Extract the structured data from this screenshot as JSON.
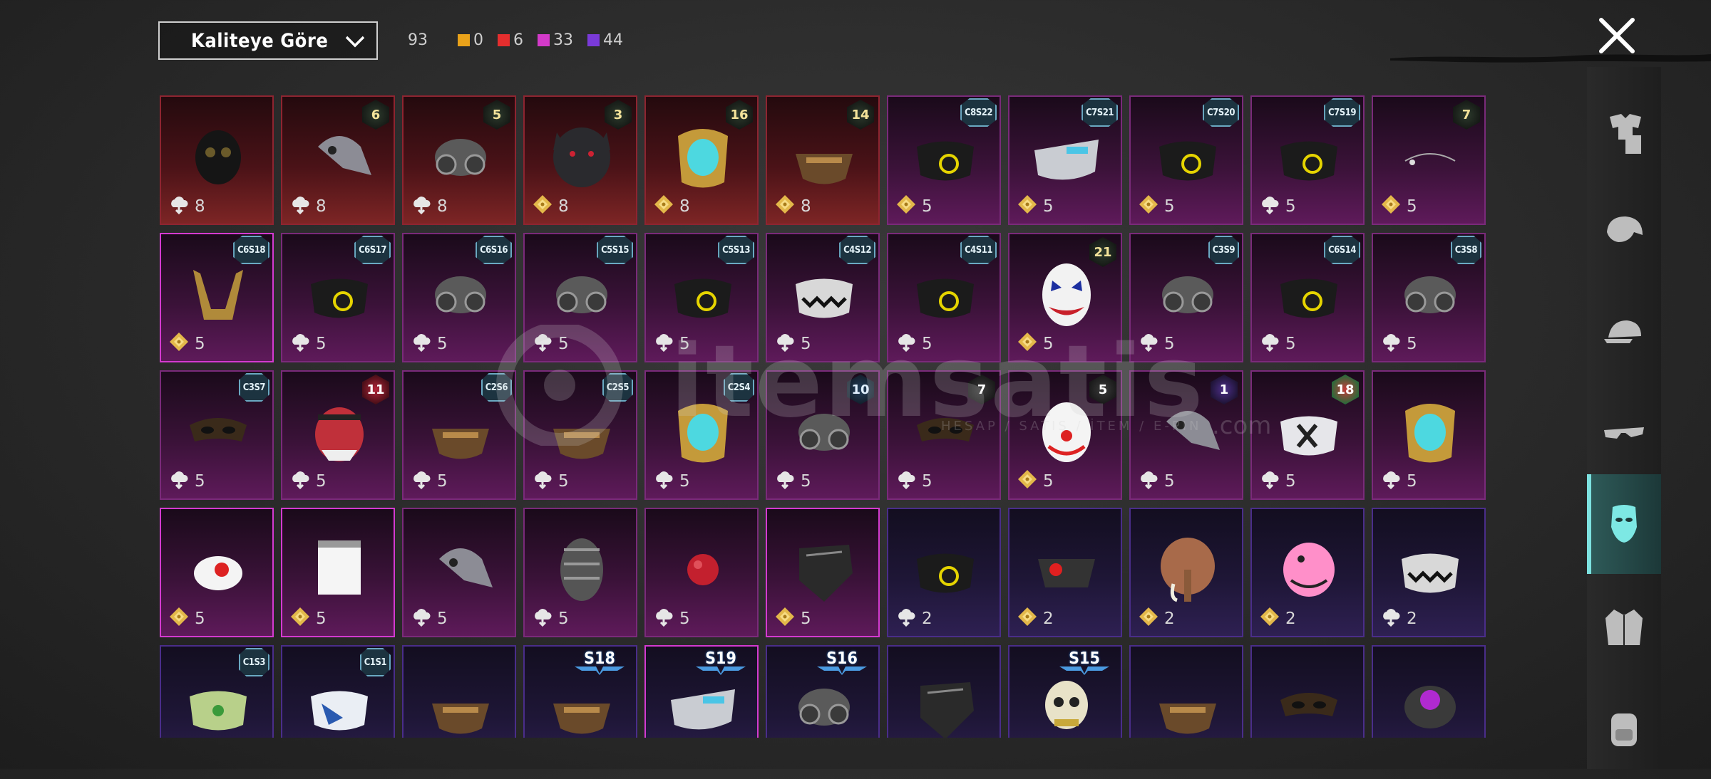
{
  "header": {
    "sort_label": "Kaliteye Göre",
    "total_count": "93",
    "rarities": [
      {
        "color": "#e9a21a",
        "count": "0"
      },
      {
        "color": "#e52e2e",
        "count": "6"
      },
      {
        "color": "#d33ac9",
        "count": "33"
      },
      {
        "color": "#7a3ad9",
        "count": "44"
      }
    ]
  },
  "watermark": {
    "text": "itemsatis",
    "sub": "HESAP / SATIŞ / İTEM / E-PIN",
    "suffix": ".com"
  },
  "items": [
    {
      "rarity": "red",
      "badge": "",
      "count": "8",
      "icon": "cloud-icon",
      "shape": "round-mask"
    },
    {
      "rarity": "red",
      "badge": "6",
      "badge_type": "level",
      "count": "8",
      "icon": "cloud-icon",
      "shape": "plague-mask"
    },
    {
      "rarity": "red",
      "badge": "5",
      "badge_type": "level",
      "count": "8",
      "icon": "cloud-icon",
      "shape": "gas-mask"
    },
    {
      "rarity": "red",
      "badge": "3",
      "badge_type": "level",
      "count": "8",
      "icon": "diamond-icon",
      "shape": "wolf-mask"
    },
    {
      "rarity": "red",
      "badge": "16",
      "badge_type": "level",
      "count": "8",
      "icon": "diamond-icon",
      "shape": "golden-mask"
    },
    {
      "rarity": "red",
      "badge": "14",
      "badge_type": "level",
      "count": "8",
      "icon": "diamond-icon",
      "shape": "half-mask"
    },
    {
      "rarity": "purple",
      "badge": "C8S22",
      "badge_type": "season",
      "count": "5",
      "icon": "diamond-icon",
      "shape": "face-mask"
    },
    {
      "rarity": "purple",
      "badge": "C7S21",
      "badge_type": "season",
      "count": "5",
      "icon": "diamond-icon",
      "shape": "visor-mask"
    },
    {
      "rarity": "purple",
      "badge": "C7S20",
      "badge_type": "season",
      "count": "5",
      "icon": "diamond-icon",
      "shape": "face-mask"
    },
    {
      "rarity": "purple",
      "badge": "C7S19",
      "badge_type": "season",
      "count": "5",
      "icon": "cloud-icon",
      "shape": "face-mask"
    },
    {
      "rarity": "purple",
      "badge": "7",
      "badge_type": "level",
      "count": "5",
      "icon": "diamond-icon",
      "shape": "wire-mask"
    },
    {
      "rarity": "purple",
      "badge": "C6S18",
      "badge_type": "season",
      "count": "5",
      "icon": "diamond-icon",
      "shape": "jaw-mask",
      "selected": true
    },
    {
      "rarity": "purple",
      "badge": "C6S17",
      "badge_type": "season",
      "count": "5",
      "icon": "cloud-icon",
      "shape": "face-mask"
    },
    {
      "rarity": "purple",
      "badge": "C6S16",
      "badge_type": "season",
      "count": "5",
      "icon": "cloud-icon",
      "shape": "gas-mask"
    },
    {
      "rarity": "purple",
      "badge": "C5S15",
      "badge_type": "season",
      "count": "5",
      "icon": "cloud-icon",
      "shape": "gas-mask"
    },
    {
      "rarity": "purple",
      "badge": "C5S13",
      "badge_type": "season",
      "count": "5",
      "icon": "cloud-icon",
      "shape": "face-mask"
    },
    {
      "rarity": "purple",
      "badge": "C4S12",
      "badge_type": "season",
      "count": "5",
      "icon": "cloud-icon",
      "shape": "teeth-mask"
    },
    {
      "rarity": "purple",
      "badge": "C4S11",
      "badge_type": "season",
      "count": "5",
      "icon": "cloud-icon",
      "shape": "face-mask"
    },
    {
      "rarity": "purple",
      "badge": "21",
      "badge_type": "level",
      "count": "5",
      "icon": "diamond-icon",
      "shape": "joker-mask"
    },
    {
      "rarity": "purple",
      "badge": "C3S9",
      "badge_type": "season",
      "count": "5",
      "icon": "cloud-icon",
      "shape": "gas-mask"
    },
    {
      "rarity": "purple",
      "badge": "C6S14",
      "badge_type": "season",
      "count": "5",
      "icon": "cloud-icon",
      "shape": "face-mask"
    },
    {
      "rarity": "purple",
      "badge": "C3S8",
      "badge_type": "season",
      "count": "5",
      "icon": "cloud-icon",
      "shape": "gas-mask"
    },
    {
      "rarity": "purple",
      "badge": "C3S7",
      "badge_type": "season",
      "count": "5",
      "icon": "cloud-icon",
      "shape": "masquerade"
    },
    {
      "rarity": "purple",
      "badge": "11",
      "badge_type": "level",
      "badge_color": "red",
      "count": "5",
      "icon": "cloud-icon",
      "shape": "oni-mask"
    },
    {
      "rarity": "purple",
      "badge": "C2S6",
      "badge_type": "season",
      "count": "5",
      "icon": "cloud-icon",
      "shape": "half-mask"
    },
    {
      "rarity": "purple",
      "badge": "C2S5",
      "badge_type": "season",
      "count": "5",
      "icon": "cloud-icon",
      "shape": "half-mask"
    },
    {
      "rarity": "purple",
      "badge": "C2S4",
      "badge_type": "season",
      "count": "5",
      "icon": "cloud-icon",
      "shape": "golden-mask"
    },
    {
      "rarity": "purple",
      "badge": "10",
      "badge_type": "level",
      "badge_color": "blue",
      "count": "5",
      "icon": "cloud-icon",
      "shape": "gas-mask"
    },
    {
      "rarity": "purple",
      "badge": "7",
      "badge_type": "level",
      "badge_color": "grey",
      "count": "5",
      "icon": "cloud-icon",
      "shape": "masquerade"
    },
    {
      "rarity": "purple",
      "badge": "5",
      "badge_type": "level",
      "badge_color": "grey",
      "count": "5",
      "icon": "diamond-icon",
      "shape": "clown-mask"
    },
    {
      "rarity": "purple",
      "badge": "1",
      "badge_type": "level",
      "badge_color": "violet",
      "count": "5",
      "icon": "cloud-icon",
      "shape": "plague-mask"
    },
    {
      "rarity": "purple",
      "badge": "18",
      "badge_type": "level",
      "badge_color": "greenred",
      "count": "5",
      "icon": "cloud-icon",
      "shape": "x-mask"
    },
    {
      "rarity": "purple",
      "badge": "",
      "count": "5",
      "icon": "cloud-icon",
      "shape": "golden-mask"
    },
    {
      "rarity": "purple",
      "badge": "",
      "count": "5",
      "icon": "diamond-icon",
      "shape": "cap-mask",
      "selected": true
    },
    {
      "rarity": "purple",
      "badge": "",
      "count": "5",
      "icon": "diamond-icon",
      "shape": "cloth-mask",
      "selected": true
    },
    {
      "rarity": "purple",
      "badge": "",
      "count": "5",
      "icon": "cloud-icon",
      "shape": "plague-mask"
    },
    {
      "rarity": "purple",
      "badge": "",
      "count": "5",
      "icon": "cloud-icon",
      "shape": "stripe-mask"
    },
    {
      "rarity": "purple",
      "badge": "",
      "count": "5",
      "icon": "cloud-icon",
      "shape": "red-nose"
    },
    {
      "rarity": "purple",
      "badge": "",
      "count": "5",
      "icon": "diamond-icon",
      "shape": "bandana",
      "selected": true
    },
    {
      "rarity": "violet",
      "badge": "",
      "count": "2",
      "icon": "cloud-icon",
      "shape": "face-mask"
    },
    {
      "rarity": "violet",
      "badge": "",
      "count": "2",
      "icon": "diamond-icon",
      "shape": "eye-mask"
    },
    {
      "rarity": "violet",
      "badge": "",
      "count": "2",
      "icon": "diamond-icon",
      "shape": "mammoth-mask"
    },
    {
      "rarity": "violet",
      "badge": "",
      "count": "2",
      "icon": "diamond-icon",
      "shape": "dino-mask"
    },
    {
      "rarity": "violet",
      "badge": "",
      "count": "2",
      "icon": "cloud-icon",
      "shape": "teeth-mask"
    },
    {
      "rarity": "violet",
      "badge": "C1S3",
      "badge_type": "season",
      "count": "",
      "icon": "",
      "shape": "green-mask"
    },
    {
      "rarity": "violet",
      "badge": "C1S1",
      "badge_type": "season",
      "count": "",
      "icon": "",
      "shape": "blue-mask"
    },
    {
      "rarity": "violet",
      "badge": "",
      "count": "",
      "icon": "",
      "shape": "half-mask"
    },
    {
      "rarity": "violet",
      "badge": "S18",
      "badge_type": "s",
      "count": "",
      "icon": "",
      "shape": "half-mask"
    },
    {
      "rarity": "violet",
      "badge": "S19",
      "badge_type": "s",
      "count": "",
      "icon": "",
      "shape": "visor-mask",
      "selected": true
    },
    {
      "rarity": "violet",
      "badge": "S16",
      "badge_type": "s",
      "count": "",
      "icon": "",
      "shape": "gas-mask"
    },
    {
      "rarity": "violet",
      "badge": "",
      "count": "",
      "icon": "",
      "shape": "bandana"
    },
    {
      "rarity": "violet",
      "badge": "S15",
      "badge_type": "s",
      "count": "",
      "icon": "",
      "shape": "skull-mask"
    },
    {
      "rarity": "violet",
      "badge": "",
      "count": "",
      "icon": "",
      "shape": "half-mask"
    },
    {
      "rarity": "violet",
      "badge": "",
      "count": "",
      "icon": "",
      "shape": "masquerade"
    },
    {
      "rarity": "violet",
      "badge": "",
      "count": "",
      "icon": "",
      "shape": "purple-mask"
    }
  ],
  "nav": [
    {
      "name": "outfit-tab",
      "icon": "outfit-icon"
    },
    {
      "name": "headwear-tab",
      "icon": "hair-icon"
    },
    {
      "name": "hat-tab",
      "icon": "cap-icon"
    },
    {
      "name": "glasses-tab",
      "icon": "glasses-icon"
    },
    {
      "name": "mask-tab",
      "icon": "mask-icon",
      "active": true
    },
    {
      "name": "jacket-tab",
      "icon": "jacket-icon"
    },
    {
      "name": "backpack-tab",
      "icon": "backpack-icon"
    }
  ]
}
